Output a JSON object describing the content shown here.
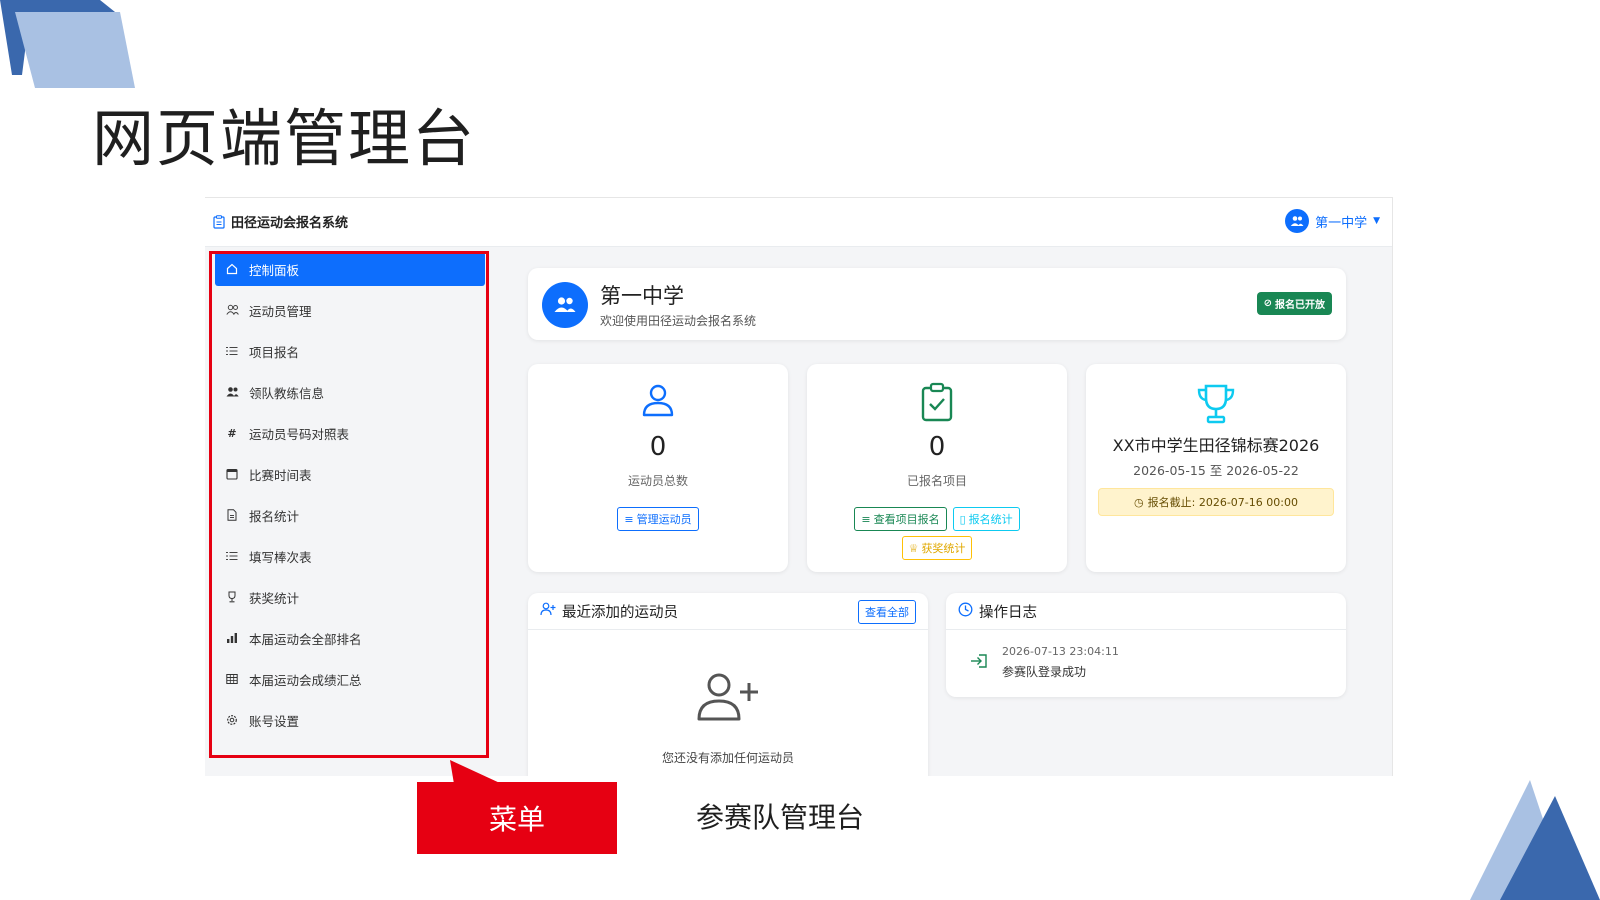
{
  "slide": {
    "title": "网页端管理台",
    "callout": "菜单",
    "caption": "参赛队管理台",
    "accent_color": "#e60012"
  },
  "app": {
    "brand": "田径运动会报名系统",
    "user": "第一中学",
    "primary_color": "#0d6efd"
  },
  "sidebar": {
    "items": [
      {
        "label": "控制面板",
        "icon": "home-icon",
        "active": true
      },
      {
        "label": "运动员管理",
        "icon": "people-icon"
      },
      {
        "label": "项目报名",
        "icon": "list-icon"
      },
      {
        "label": "领队教练信息",
        "icon": "people-fill-icon"
      },
      {
        "label": "运动员号码对照表",
        "icon": "hash-icon"
      },
      {
        "label": "比赛时间表",
        "icon": "calendar-icon"
      },
      {
        "label": "报名统计",
        "icon": "file-icon"
      },
      {
        "label": "填写棒次表",
        "icon": "list-icon"
      },
      {
        "label": "获奖统计",
        "icon": "trophy-icon"
      },
      {
        "label": "本届运动会全部排名",
        "icon": "bar-chart-icon"
      },
      {
        "label": "本届运动会成绩汇总",
        "icon": "table-icon"
      },
      {
        "label": "账号设置",
        "icon": "gear-icon"
      }
    ]
  },
  "welcome": {
    "title": "第一中学",
    "subtitle": "欢迎使用田径运动会报名系统",
    "badge": "报名已开放",
    "badge_color": "#198754"
  },
  "stats": {
    "athletes": {
      "value": "0",
      "label": "运动员总数",
      "button": "管理运动员"
    },
    "events": {
      "value": "0",
      "label": "已报名项目",
      "buttons": [
        "查看项目报名",
        "报名统计",
        "获奖统计"
      ]
    },
    "competition": {
      "title": "XX市中学生田径锦标赛2026",
      "dates": "2026-05-15 至 2026-05-22",
      "deadline": "报名截止: 2026-07-16 00:00"
    }
  },
  "recent": {
    "title": "最近添加的运动员",
    "view_all": "查看全部",
    "empty": "您还没有添加任何运动员"
  },
  "log": {
    "title": "操作日志",
    "entries": [
      {
        "time": "2026-07-13 23:04:11",
        "message": "参赛队登录成功"
      }
    ]
  }
}
